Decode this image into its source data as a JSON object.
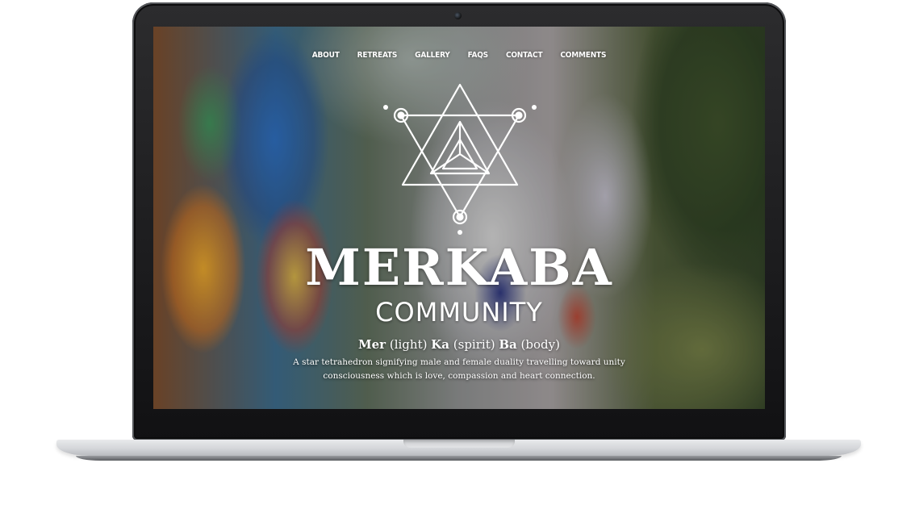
{
  "nav": {
    "items": [
      {
        "label": "ABOUT"
      },
      {
        "label": "RETREATS"
      },
      {
        "label": "GALLERY"
      },
      {
        "label": "FAQS"
      },
      {
        "label": "CONTACT"
      },
      {
        "label": "COMMENTS"
      }
    ]
  },
  "hero": {
    "logo_icon": "star-tetrahedron-icon",
    "title": "MERKABA",
    "subtitle": "COMMUNITY",
    "etymology": {
      "word1": "Mer",
      "meaning1": "(light)",
      "word2": "Ka",
      "meaning2": "(spirit)",
      "word3": "Ba",
      "meaning3": "(body)"
    },
    "tagline_line1": "A star tetrahedron signifying male and female duality travelling toward unity",
    "tagline_line2": "consciousness which is love, compassion and heart connection."
  },
  "colors": {
    "text": "#ffffff",
    "bezel": "#1a1a1c",
    "aluminum": "#d4d6d9"
  }
}
